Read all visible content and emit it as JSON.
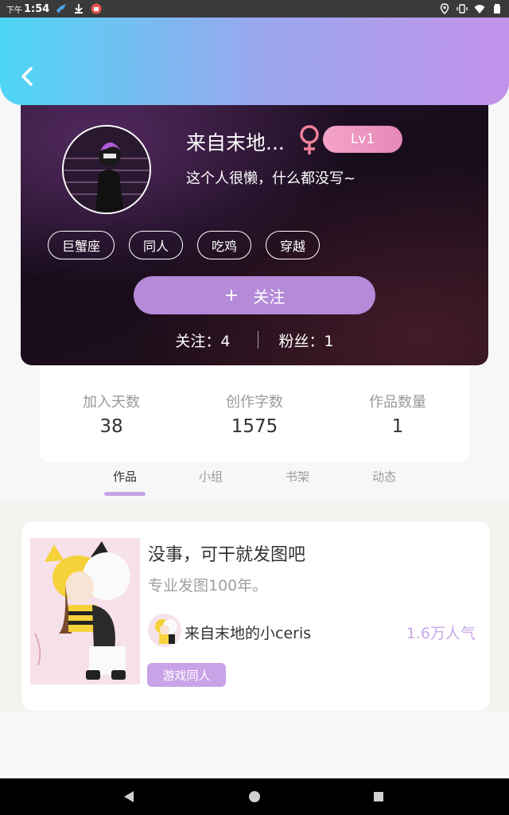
{
  "status_bar": {
    "time_prefix": "下午",
    "time": "1:54",
    "left_icons": [
      "bird-icon",
      "download-icon",
      "app-notification-icon"
    ],
    "right_icons": [
      "location-icon",
      "vibrate-icon",
      "wifi-icon",
      "battery-icon"
    ]
  },
  "header": {
    "back_icon": "chevron-left-icon",
    "gradient_colors": [
      "#4dd6f5",
      "#98a8ef",
      "#c392ea"
    ]
  },
  "profile": {
    "username": "来自末地...",
    "gender_icon": "female-icon",
    "gender_color": "#f0829b",
    "level": "Lv1",
    "bio": "这个人很懒，什么都没写~",
    "tags": [
      "巨蟹座",
      "同人",
      "吃鸡",
      "穿越"
    ],
    "follow_button": {
      "plus": "+",
      "label": "关注"
    },
    "following": "关注：4",
    "followers": "粉丝：1"
  },
  "stats": [
    {
      "label": "加入天数",
      "value": "38"
    },
    {
      "label": "创作字数",
      "value": "1575"
    },
    {
      "label": "作品数量",
      "value": "1"
    }
  ],
  "tabs": [
    {
      "label": "作品",
      "active": true
    },
    {
      "label": "小组",
      "active": false
    },
    {
      "label": "书架",
      "active": false
    },
    {
      "label": "动态",
      "active": false
    }
  ],
  "works": [
    {
      "title": "没事，可干就发图吧",
      "description": "专业发图100年。",
      "author": "来自末地的小ceris",
      "popularity": "1.6万人气",
      "category": "游戏同人"
    }
  ],
  "nav_bar": {
    "icons": [
      "back-triangle-icon",
      "home-circle-icon",
      "recents-square-icon"
    ]
  },
  "colors": {
    "accent_purple": "#b58ad8",
    "level_pink": "#e98abb",
    "popularity_text": "#c9a8e8",
    "tab_indicator": "#c6a4e4"
  }
}
